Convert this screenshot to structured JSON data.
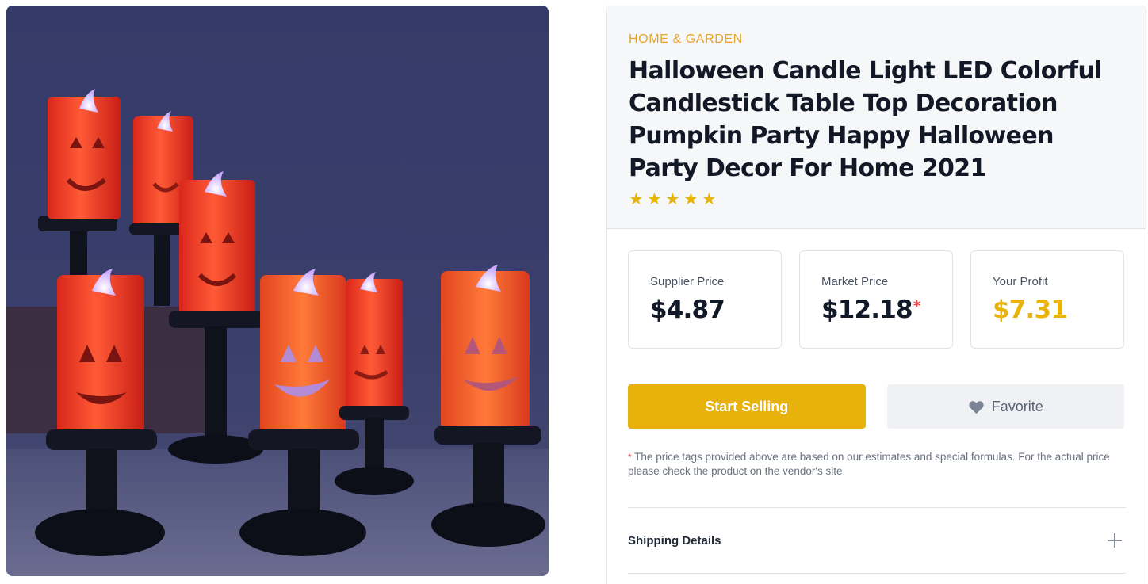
{
  "product": {
    "image_alt": "Halloween pumpkin LED candles on black candlesticks",
    "category": "HOME & GARDEN",
    "title": "Halloween Candle Light LED Colorful Candlestick Table Top Decoration Pumpkin Party Happy Halloween Party Decor For Home 2021",
    "rating": 5,
    "star_glyph": "★"
  },
  "prices": {
    "supplier": {
      "label": "Supplier Price",
      "value": "$4.87"
    },
    "market": {
      "label": "Market Price",
      "value": "$12.18",
      "marker": "*"
    },
    "profit": {
      "label": "Your Profit",
      "value": "$7.31"
    }
  },
  "actions": {
    "start_selling": "Start Selling",
    "favorite": "Favorite"
  },
  "disclaimer": {
    "marker": "*",
    "text": " The price tags provided above are based on our estimates and special formulas. For the actual price please check the product on the vendor's site"
  },
  "accordion": {
    "shipping_label": "Shipping Details"
  },
  "colors": {
    "accent": "#e8b20c",
    "category": "#e7a42c",
    "profit": "#eab308",
    "asterisk": "#ef4444"
  }
}
